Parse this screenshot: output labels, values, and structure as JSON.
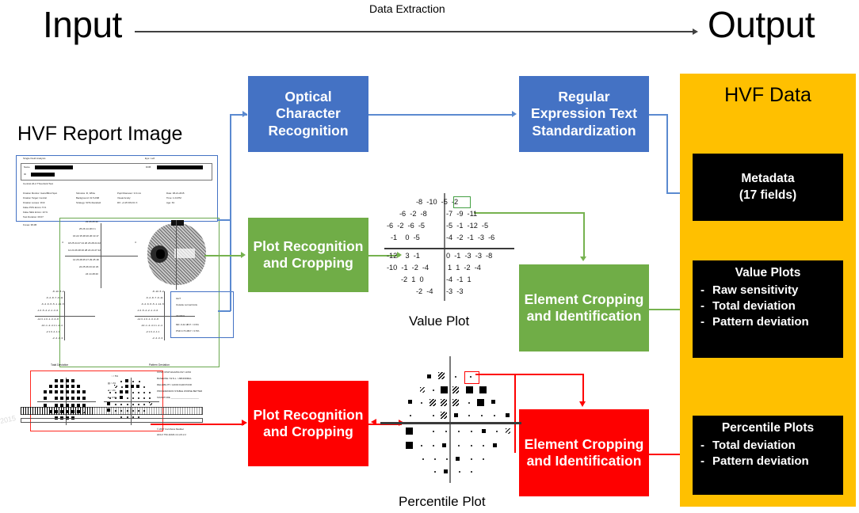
{
  "header": {
    "input_title": "Input",
    "output_title": "Output",
    "arrow_label": "Data Extraction"
  },
  "input": {
    "report_caption": "HVF Report Image",
    "watermark": "2015",
    "report": {
      "title": "Single Field Analysis",
      "eye_label": "Eye: Left",
      "name_label": "Name",
      "dob_label": "DOB",
      "id_label": "ID",
      "test_type": "Central 24-2 Threshold Test",
      "params_col1": [
        "Fixation Monitor: Gaze/Blind Spot",
        "Fixation Target: Central",
        "Fixation Losses: 3/19",
        "False POS Errors: 5 %",
        "False NEG Errors: 10 %",
        "Test Duration: 06:07",
        "Fovea: 38 dB"
      ],
      "params_col2": [
        "Stimulus: III, White",
        "Background: 31.5 ASB",
        "Strategy: SITA-Standard"
      ],
      "params_col3": [
        "Pupil Diameter: 3.9 mm",
        "Visual Acuity:",
        "RX: +3.25 DS    DC    X"
      ],
      "params_col4": [
        "Date: 08-21-2015",
        "Time: 1:24 PM",
        "Age: 63"
      ],
      "ght": {
        "title": "GHT",
        "result": "Outside normal limits",
        "vfi": "VFI     81%",
        "md": "MD    -9.42 dB  P < 0.5%",
        "psd": "PSD    3.70 dB  P < 0.5%"
      },
      "deviation_captions": [
        "Total Deviation",
        "Pattern Deviation"
      ],
      "legend": [
        ":: < 5%",
        "▨ < 2%",
        "▰ < 1%",
        "■ < 0.5%"
      ],
      "footer_block": [
        "UCSF OPHTHALMOLOGY HVF2",
        "BASELINE / W.N.L. / ABNORMAL",
        "RELIABILITY: GOOD  FAIR  POOR",
        "PROGRESSION STABLE  WORSE  BETTER",
        "SIGNATURE ______________________"
      ],
      "copyright": "© 2007 Carl Zeiss Meditec",
      "model_line": "HFA II 750-11620-4.2.2/4.2.2"
    }
  },
  "process": {
    "ocr": "Optical Character Recognition",
    "regex": "Regular Expression Text Standardization",
    "plot_recognition_green": "Plot Recognition and Cropping",
    "element_green": "Element Cropping and Identification",
    "plot_recognition_red": "Plot Recognition and Cropping",
    "element_red": "Element Cropping and Identification"
  },
  "output": {
    "panel_title": "HVF Data",
    "metadata": {
      "title": "Metadata",
      "subtitle": "(17 fields)"
    },
    "value_plots": {
      "title": "Value Plots",
      "items": [
        "Raw sensitivity",
        "Total deviation",
        "Pattern deviation"
      ]
    },
    "percentile_plots": {
      "title": "Percentile Plots",
      "items": [
        "Total deviation",
        "Pattern deviation"
      ]
    }
  },
  "plots": {
    "value_plot_caption": "Value Plot",
    "percentile_plot_caption": "Percentile Plot",
    "value_plot_rows": [
      {
        "left": [],
        "right": [
          "-8",
          "-10",
          "-5",
          "-2"
        ]
      },
      {
        "left": [
          "-6",
          "-2",
          "-8"
        ],
        "right": [
          "-7",
          "-9",
          "-11"
        ]
      },
      {
        "left": [
          "-6",
          "-2",
          "-6",
          "-5"
        ],
        "right": [
          "-5",
          "-1",
          "-12",
          "-5"
        ]
      },
      {
        "left": [
          "-1",
          "",
          "0",
          "-5"
        ],
        "right": [
          "-4",
          "-2",
          "-1",
          "-3",
          "-6"
        ]
      },
      {
        "left": [
          "-12",
          "",
          "3",
          "-1"
        ],
        "right": [
          "0",
          "-1",
          "-3",
          "-3",
          "-8"
        ]
      },
      {
        "left": [
          "-10",
          "-1",
          "-2",
          "-4"
        ],
        "right": [
          "1",
          "1",
          "-2",
          "-4"
        ]
      },
      {
        "left": [
          "-2",
          "1",
          "0"
        ],
        "right": [
          "-4",
          "-1",
          "1"
        ]
      },
      {
        "left": [
          "-2",
          "-4"
        ],
        "right": [
          "-3",
          "-3"
        ]
      }
    ],
    "value_plot_highlight": "-2",
    "percentile_symbols_legend": [
      "dot",
      "q4",
      "hatch",
      "half",
      "solid"
    ]
  }
}
